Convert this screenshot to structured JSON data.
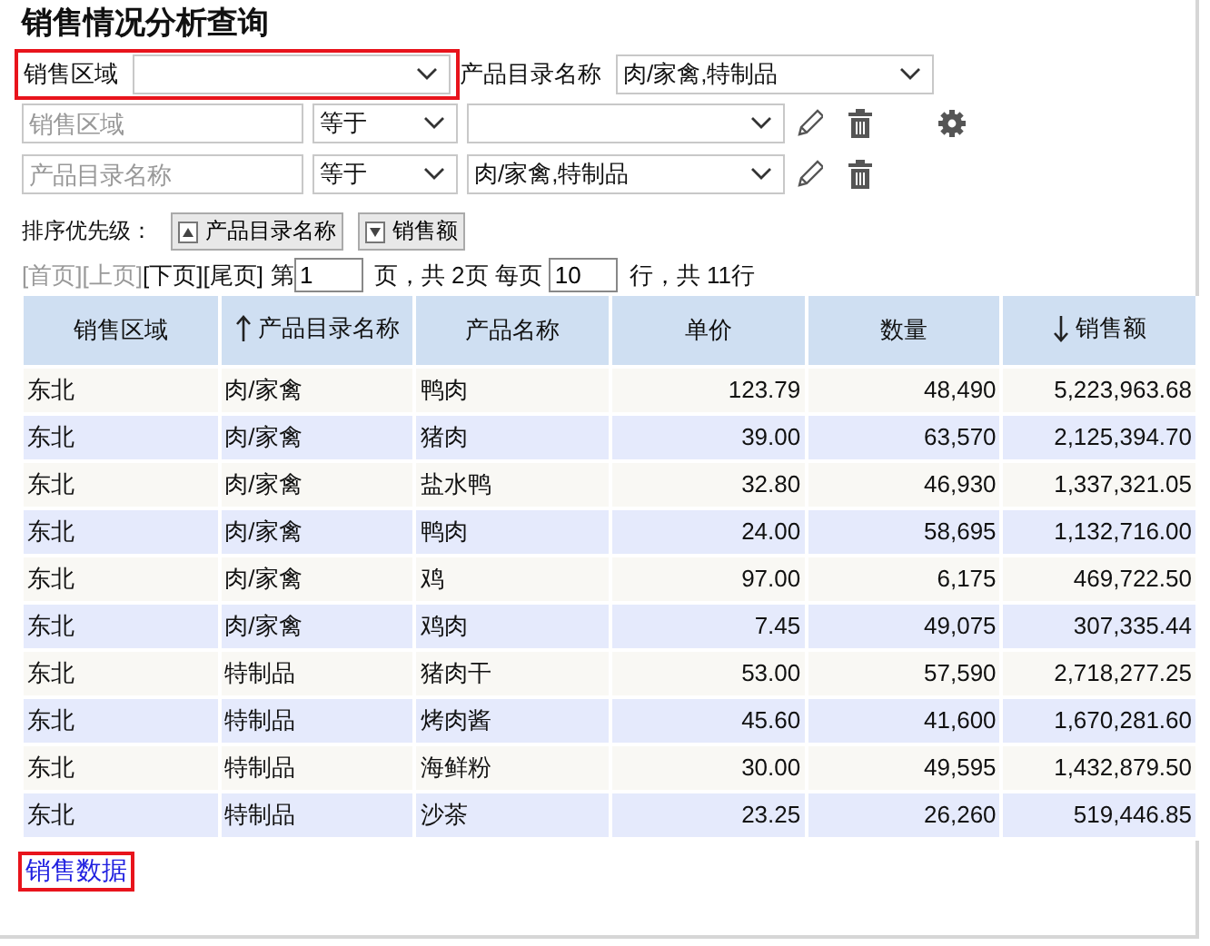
{
  "title": "销售情况分析查询",
  "parameters": [
    {
      "label": "销售区域",
      "highlighted": true
    },
    {
      "label": "产品目录名称",
      "value": "肉/家禽,特制品",
      "highlighted": false
    }
  ],
  "filters": [
    {
      "field": {
        "placeholder": "销售区域"
      },
      "operator": "等于",
      "settings": true
    },
    {
      "field": {
        "placeholder": "产品目录名称"
      },
      "operator": "等于",
      "value": "肉/家禽,特制品",
      "settings": false
    }
  ],
  "sort": {
    "label": "排序优先级：",
    "items": [
      {
        "label": "产品目录名称",
        "ascending": true
      },
      {
        "label": "销售额",
        "ascending": false
      }
    ]
  },
  "pager": {
    "links": [
      {
        "label": "[首页]",
        "disabled": true
      },
      {
        "label": "[上页]",
        "disabled": true
      },
      {
        "label": "[下页]",
        "disabled": false
      },
      {
        "label": "[尾页]",
        "disabled": false
      }
    ],
    "prefix": "第",
    "page": "1",
    "middle": "页，共 2页 每页",
    "per_page": "10",
    "suffix": "行，共 11行"
  },
  "table": {
    "columns": [
      {
        "label": "销售区域",
        "kind": "text"
      },
      {
        "label": "产品目录名称",
        "kind": "text",
        "sorted": true,
        "ascending": true
      },
      {
        "label": "产品名称",
        "kind": "text"
      },
      {
        "label": "单价",
        "kind": "number"
      },
      {
        "label": "数量",
        "kind": "number"
      },
      {
        "label": "销售额",
        "kind": "number",
        "sorted": true,
        "ascending": false
      }
    ],
    "rows": [
      [
        "东北",
        "肉/家禽",
        "鸭肉",
        "123.79",
        "48,490",
        "5,223,963.68"
      ],
      [
        "东北",
        "肉/家禽",
        "猪肉",
        "39.00",
        "63,570",
        "2,125,394.70"
      ],
      [
        "东北",
        "肉/家禽",
        "盐水鸭",
        "32.80",
        "46,930",
        "1,337,321.05"
      ],
      [
        "东北",
        "肉/家禽",
        "鸭肉",
        "24.00",
        "58,695",
        "1,132,716.00"
      ],
      [
        "东北",
        "肉/家禽",
        "鸡",
        "97.00",
        "6,175",
        "469,722.50"
      ],
      [
        "东北",
        "肉/家禽",
        "鸡肉",
        "7.45",
        "49,075",
        "307,335.44"
      ],
      [
        "东北",
        "特制品",
        "猪肉干",
        "53.00",
        "57,590",
        "2,718,277.25"
      ],
      [
        "东北",
        "特制品",
        "烤肉酱",
        "45.60",
        "41,600",
        "1,670,281.60"
      ],
      [
        "东北",
        "特制品",
        "海鲜粉",
        "30.00",
        "49,595",
        "1,432,879.50"
      ],
      [
        "东北",
        "特制品",
        "沙茶",
        "23.25",
        "26,260",
        "519,446.85"
      ]
    ]
  },
  "link": {
    "label": "销售数据",
    "highlighted": true
  }
}
